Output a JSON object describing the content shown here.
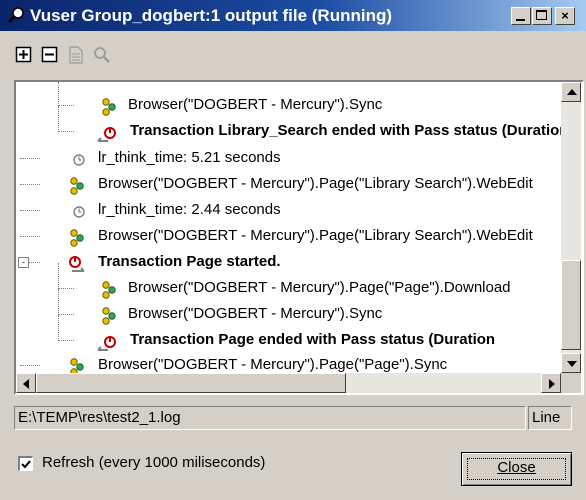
{
  "window": {
    "title": "Vuser Group_dogbert:1 output file (Running)",
    "min_glyph": "_",
    "max_glyph": "□",
    "close_glyph": "×"
  },
  "toolbar": {
    "buttons": [
      "expand-all",
      "collapse-all",
      "view-script",
      "find"
    ]
  },
  "log": {
    "rows": [
      {
        "text": "Browser(\"DOGBERT - Mercury\").Sync",
        "icon": "vuser-step-icon",
        "bold": false
      },
      {
        "text": "Transaction Library_Search ended with Pass status (Duration",
        "icon": "transaction-end-icon",
        "bold": true
      },
      {
        "text": "lr_think_time: 5.21 seconds",
        "icon": "think-time-icon",
        "bold": false
      },
      {
        "text": "Browser(\"DOGBERT - Mercury\").Page(\"Library Search\").WebEdit",
        "icon": "vuser-step-icon",
        "bold": false
      },
      {
        "text": "lr_think_time: 2.44 seconds",
        "icon": "think-time-icon",
        "bold": false
      },
      {
        "text": "Browser(\"DOGBERT - Mercury\").Page(\"Library Search\").WebEdit",
        "icon": "vuser-step-icon",
        "bold": false
      },
      {
        "text": "Transaction Page started.",
        "icon": "transaction-start-icon",
        "bold": true
      },
      {
        "text": "Browser(\"DOGBERT - Mercury\").Page(\"Page\").Download",
        "icon": "vuser-step-icon",
        "bold": false
      },
      {
        "text": "Browser(\"DOGBERT - Mercury\").Sync",
        "icon": "vuser-step-icon",
        "bold": false
      },
      {
        "text": "Transaction Page ended with Pass status (Duration",
        "icon": "transaction-end-icon",
        "bold": true
      },
      {
        "text": "Browser(\"DOGBERT - Mercury\").Page(\"Page\").Sync",
        "icon": "vuser-step-icon",
        "bold": false
      }
    ]
  },
  "status_bar": {
    "path": "E:\\TEMP\\res\\test2_1.log",
    "line_label": "Line"
  },
  "refresh": {
    "checked": true,
    "label": "Refresh (every 1000 miliseconds)"
  },
  "close_button": {
    "label": "Close"
  },
  "colors": {
    "title_gradient_start": "#0a246a",
    "title_gradient_end": "#a6caf0",
    "face": "#d4d0c8",
    "transaction_red": "#c00000"
  }
}
